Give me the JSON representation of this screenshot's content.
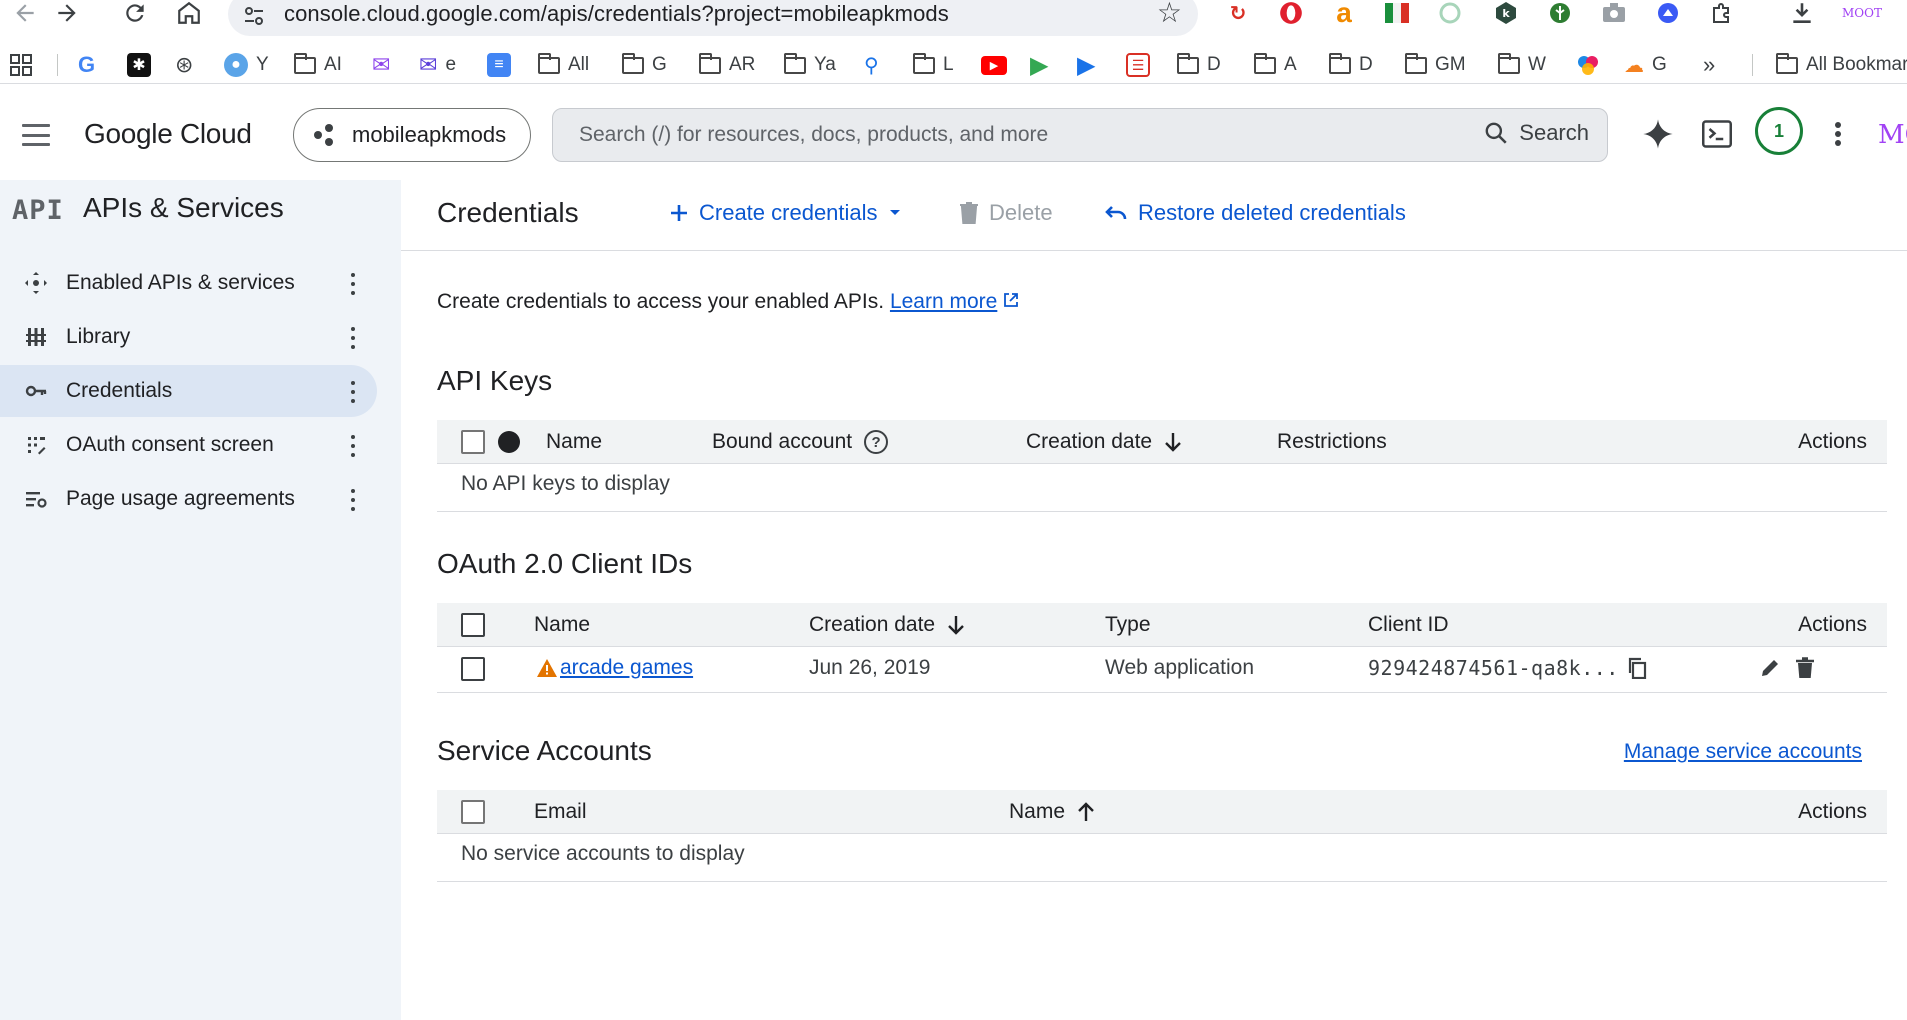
{
  "browser": {
    "url": "console.cloud.google.com/apis/credentials?project=mobileapkmods",
    "bookmarks": [
      {
        "label": "Y"
      },
      {
        "label": "AI"
      },
      {
        "label": "e"
      },
      {
        "label": "All"
      },
      {
        "label": "G"
      },
      {
        "label": "AR"
      },
      {
        "label": "Ya"
      },
      {
        "label": "L"
      },
      {
        "label": "D"
      },
      {
        "label": "A"
      },
      {
        "label": "D"
      },
      {
        "label": "GM"
      },
      {
        "label": "W"
      },
      {
        "label": "G"
      }
    ],
    "more_bookmarks": "»",
    "all_bookmarks": "All Bookmar",
    "profile_label": "MOOT"
  },
  "header": {
    "logo": "Google Cloud",
    "project": "mobileapkmods",
    "search_placeholder": "Search (/) for resources, docs, products, and more",
    "search_button": "Search",
    "notification_count": "1",
    "profile_short": "MOC"
  },
  "sidebar": {
    "api_badge": "API",
    "title": "APIs & Services",
    "items": [
      {
        "label": "Enabled APIs & services",
        "icon": "apis-icon",
        "active": false
      },
      {
        "label": "Library",
        "icon": "library-icon",
        "active": false
      },
      {
        "label": "Credentials",
        "icon": "key-icon",
        "active": true
      },
      {
        "label": "OAuth consent screen",
        "icon": "oauth-icon",
        "active": false
      },
      {
        "label": "Page usage agreements",
        "icon": "agreements-icon",
        "active": false
      }
    ]
  },
  "main": {
    "title": "Credentials",
    "create_label": "Create credentials",
    "delete_label": "Delete",
    "restore_label": "Restore deleted credentials",
    "intro_text": "Create credentials to access your enabled APIs.",
    "learn_more": "Learn more",
    "api_keys": {
      "title": "API Keys",
      "columns": [
        "Name",
        "Bound account",
        "Creation date",
        "Restrictions",
        "Actions"
      ],
      "empty": "No API keys to display"
    },
    "oauth": {
      "title": "OAuth 2.0 Client IDs",
      "columns": [
        "Name",
        "Creation date",
        "Type",
        "Client ID",
        "Actions"
      ],
      "rows": [
        {
          "name": "arcade games",
          "created": "Jun 26, 2019",
          "type": "Web application",
          "client_id": "929424874561-qa8k..."
        }
      ]
    },
    "service_accounts": {
      "title": "Service Accounts",
      "manage_link": "Manage service accounts",
      "columns": [
        "Email",
        "Name",
        "Actions"
      ],
      "empty": "No service accounts to display"
    }
  },
  "colors": {
    "accent": "#0b57d0",
    "sidebar_bg": "#f0f4f9",
    "active_item_bg": "#dbe5f3",
    "warning": "#e37400",
    "notification": "#188038"
  }
}
